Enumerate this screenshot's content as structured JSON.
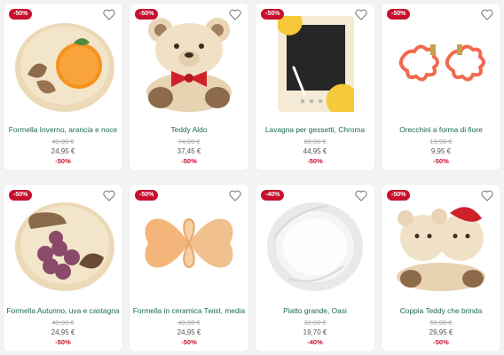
{
  "products": [
    {
      "name": "Formella Inverno, arancia e noce",
      "old_price": "49,90 €",
      "price": "24,95 €",
      "discount": "-50%",
      "badge": "-50%"
    },
    {
      "name": "Teddy Aldo",
      "old_price": "74,90 €",
      "price": "37,45 €",
      "discount": "-50%",
      "badge": "-50%"
    },
    {
      "name": "Lavagna per gessetti, Chroma",
      "old_price": "89,90 €",
      "price": "44,95 €",
      "discount": "-50%",
      "badge": "-50%"
    },
    {
      "name": "Orecchini a forma di fiore",
      "old_price": "19,90 €",
      "price": "9,95 €",
      "discount": "-50%",
      "badge": "-50%"
    },
    {
      "name": "Formella Autunno, uva e castagna",
      "old_price": "49,90 €",
      "price": "24,95 €",
      "discount": "-50%",
      "badge": "-50%"
    },
    {
      "name": "Formella in ceramica Twist, media",
      "old_price": "49,90 €",
      "price": "24,95 €",
      "discount": "-50%",
      "badge": "-50%"
    },
    {
      "name": "Piatto grande, Oasi",
      "old_price": "32,90 €",
      "price": "19,70 €",
      "discount": "-40%",
      "badge": "-40%"
    },
    {
      "name": "Coppia Teddy che brinda",
      "old_price": "59,90 €",
      "price": "29,95 €",
      "discount": "-50%",
      "badge": "-50%"
    }
  ],
  "colors": {
    "badge": "#c8102e",
    "name": "#1a6b4a",
    "discount": "#c8102e"
  }
}
